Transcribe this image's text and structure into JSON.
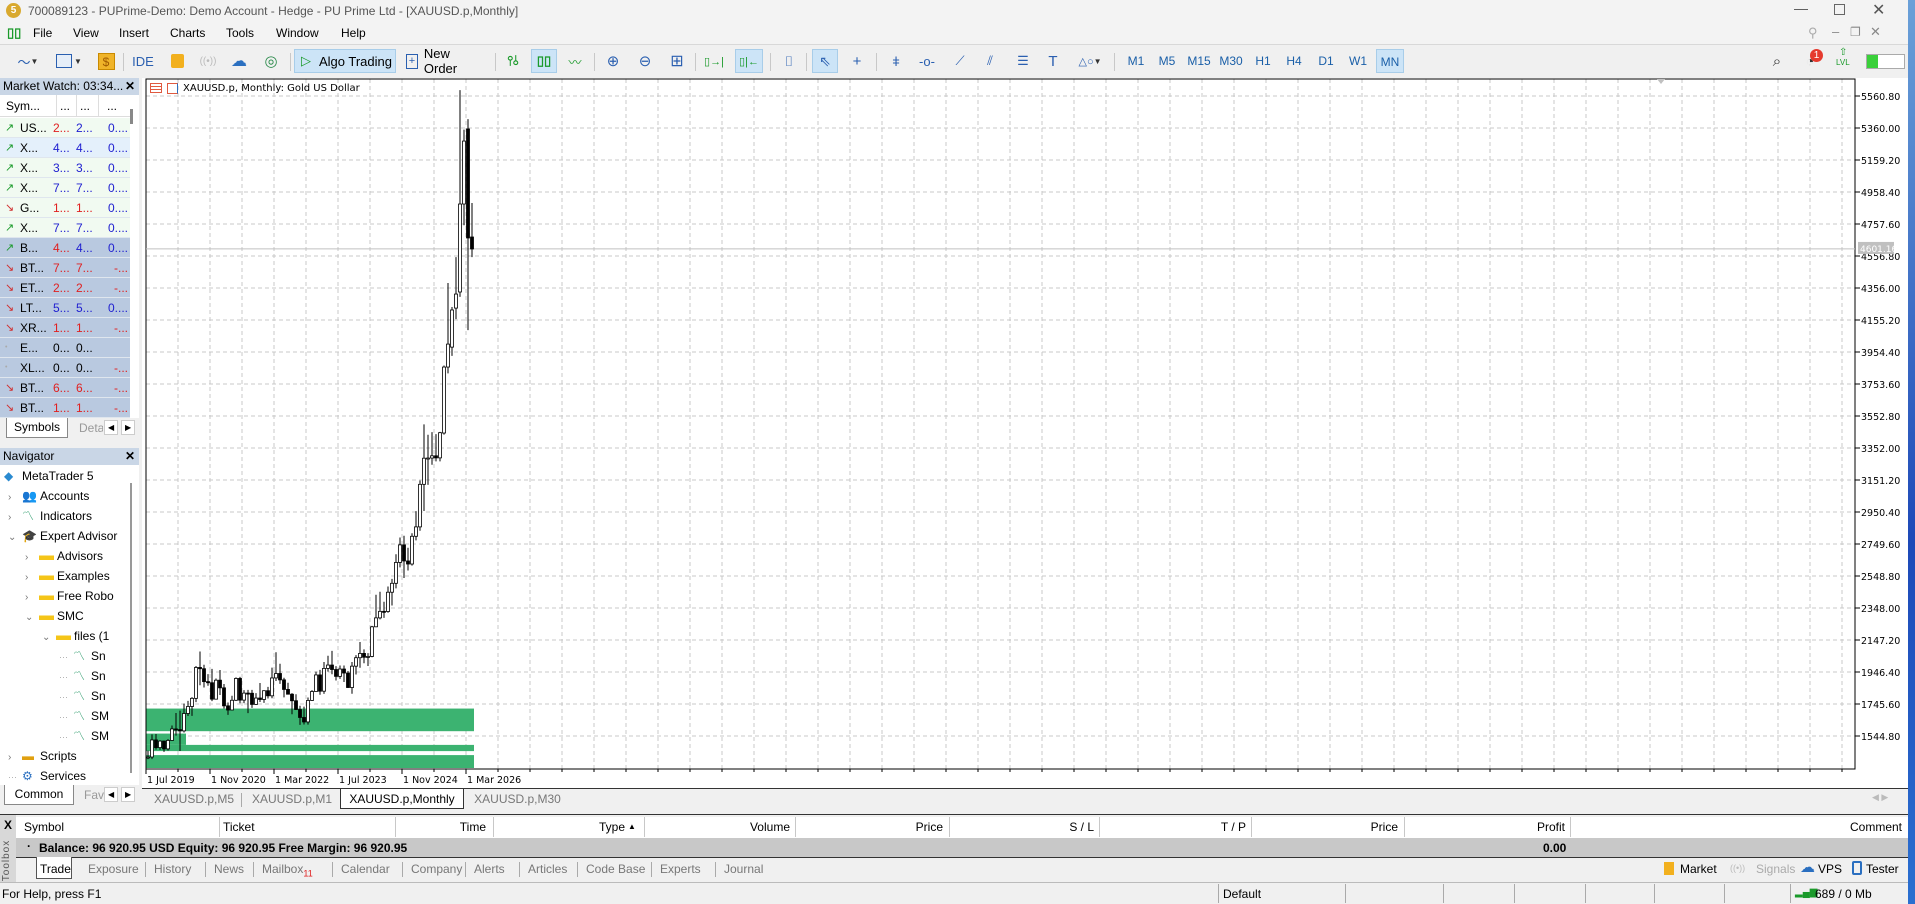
{
  "window": {
    "title": "700089123 - PUPrime-Demo: Demo Account - Hedge - PU Prime Ltd - [XAUUSD.p,Monthly]"
  },
  "menu": [
    "File",
    "View",
    "Insert",
    "Charts",
    "Tools",
    "Window",
    "Help"
  ],
  "toolbar": {
    "ide_label": "IDE",
    "algo_trading_label": "Algo Trading",
    "new_order_label": "New Order",
    "timeframes": [
      "M1",
      "M5",
      "M15",
      "M30",
      "H1",
      "H4",
      "D1",
      "W1",
      "MN"
    ],
    "active_timeframe": "MN",
    "notification_count": "1",
    "lvl_label": "LVL",
    "connection_level_pct": 30
  },
  "market_watch": {
    "title": "Market Watch: 03:34...",
    "columns": [
      "Sym...",
      "...",
      "...",
      "..."
    ],
    "rows": [
      {
        "dir": "up",
        "symbol": "US...",
        "bid": "2...",
        "ask": "2...",
        "chg": "0....",
        "bc": "#e02020",
        "ac": "#2020d0",
        "cc": "#2020d0",
        "sel": false,
        "bg": "#f1faf1"
      },
      {
        "dir": "up",
        "symbol": "X...",
        "bid": "4...",
        "ask": "4...",
        "chg": "0....",
        "bc": "#2020d0",
        "ac": "#2020d0",
        "cc": "#2020d0",
        "sel": false,
        "bg": "#e4f0fb"
      },
      {
        "dir": "up",
        "symbol": "X...",
        "bid": "3...",
        "ask": "3...",
        "chg": "0....",
        "bc": "#2020d0",
        "ac": "#2020d0",
        "cc": "#2020d0",
        "sel": false,
        "bg": "#f1faf1"
      },
      {
        "dir": "up",
        "symbol": "X...",
        "bid": "7...",
        "ask": "7...",
        "chg": "0....",
        "bc": "#2020d0",
        "ac": "#2020d0",
        "cc": "#2020d0",
        "sel": false,
        "bg": "#f1faf1"
      },
      {
        "dir": "down",
        "symbol": "G...",
        "bid": "1...",
        "ask": "1...",
        "chg": "0....",
        "bc": "#e02020",
        "ac": "#e02020",
        "cc": "#2020d0",
        "sel": false,
        "bg": "#f1faf1"
      },
      {
        "dir": "up",
        "symbol": "X...",
        "bid": "7...",
        "ask": "7...",
        "chg": "0....",
        "bc": "#2020d0",
        "ac": "#2020d0",
        "cc": "#2020d0",
        "sel": false,
        "bg": "#f1faf1"
      },
      {
        "dir": "up",
        "symbol": "B...",
        "bid": "4...",
        "ask": "4...",
        "chg": "0....",
        "bc": "#e02020",
        "ac": "#2020d0",
        "cc": "#2020d0",
        "sel": true
      },
      {
        "dir": "down",
        "symbol": "BT...",
        "bid": "7...",
        "ask": "7...",
        "chg": "-...",
        "bc": "#e02020",
        "ac": "#e02020",
        "cc": "#e02020",
        "sel": true
      },
      {
        "dir": "down",
        "symbol": "ET...",
        "bid": "2...",
        "ask": "2...",
        "chg": "-...",
        "bc": "#e02020",
        "ac": "#e02020",
        "cc": "#e02020",
        "sel": true
      },
      {
        "dir": "down",
        "symbol": "LT...",
        "bid": "5...",
        "ask": "5...",
        "chg": "0....",
        "bc": "#2020d0",
        "ac": "#2020d0",
        "cc": "#2020d0",
        "sel": true
      },
      {
        "dir": "down",
        "symbol": "XR...",
        "bid": "1...",
        "ask": "1...",
        "chg": "-...",
        "bc": "#e02020",
        "ac": "#e02020",
        "cc": "#e02020",
        "sel": true
      },
      {
        "dir": "none",
        "symbol": "E...",
        "bid": "0...",
        "ask": "0...",
        "chg": "",
        "bc": "#000000",
        "ac": "#000000",
        "cc": "#000000",
        "sel": true
      },
      {
        "dir": "none",
        "symbol": "XL...",
        "bid": "0...",
        "ask": "0...",
        "chg": "-...",
        "bc": "#000000",
        "ac": "#000000",
        "cc": "#e02020",
        "sel": true
      },
      {
        "dir": "down",
        "symbol": "BT...",
        "bid": "6...",
        "ask": "6...",
        "chg": "-...",
        "bc": "#e02020",
        "ac": "#e02020",
        "cc": "#e02020",
        "sel": true
      },
      {
        "dir": "down",
        "symbol": "BT...",
        "bid": "1...",
        "ask": "1...",
        "chg": "-...",
        "bc": "#e02020",
        "ac": "#e02020",
        "cc": "#e02020",
        "sel": true
      }
    ],
    "tabs": [
      "Symbols",
      "Deta"
    ]
  },
  "navigator": {
    "title": "Navigator",
    "items": [
      {
        "label": "MetaTrader 5",
        "icon": "metatrader-icon",
        "level": 0,
        "exp": ""
      },
      {
        "label": "Accounts",
        "icon": "accounts-icon",
        "level": 1,
        "exp": ">"
      },
      {
        "label": "Indicators",
        "icon": "indicator-icon",
        "level": 1,
        "exp": ">"
      },
      {
        "label": "Expert Advisor",
        "icon": "expert-icon",
        "level": 1,
        "exp": "v"
      },
      {
        "label": "Advisors",
        "icon": "folder-icon",
        "level": 2,
        "exp": ">"
      },
      {
        "label": "Examples",
        "icon": "folder-icon",
        "level": 2,
        "exp": ">"
      },
      {
        "label": "Free Robo",
        "icon": "folder-icon",
        "level": 2,
        "exp": ">"
      },
      {
        "label": "SMC",
        "icon": "folder-icon",
        "level": 2,
        "exp": "v"
      },
      {
        "label": "files (1",
        "icon": "folder-icon",
        "level": 3,
        "exp": "v"
      },
      {
        "label": "Sn",
        "icon": "indicator-icon",
        "level": 4,
        "exp": ""
      },
      {
        "label": "Sn",
        "icon": "indicator-icon",
        "level": 4,
        "exp": ""
      },
      {
        "label": "Sn",
        "icon": "indicator-icon",
        "level": 4,
        "exp": ""
      },
      {
        "label": "SM",
        "icon": "indicator-icon",
        "level": 4,
        "exp": ""
      },
      {
        "label": "SM",
        "icon": "indicator-icon",
        "level": 4,
        "exp": ""
      },
      {
        "label": "Scripts",
        "icon": "script-icon",
        "level": 1,
        "exp": ">"
      },
      {
        "label": "Services",
        "icon": "services-icon",
        "level": 1,
        "exp": ""
      }
    ],
    "tabs": [
      "Common",
      "Fav"
    ]
  },
  "chart": {
    "header": "XAUUSD.p, Monthly:  Gold US Dollar",
    "tabs": [
      "XAUUSD.p,M5",
      "XAUUSD.p,M1",
      "XAUUSD.p,Monthly",
      "XAUUSD.p,M30"
    ],
    "active_tab": 2
  },
  "chart_data": {
    "type": "candlestick",
    "symbol": "XAUUSD.p",
    "timeframe": "Monthly",
    "y_ticks": [
      5560.8,
      5360.0,
      5159.2,
      4958.4,
      4757.6,
      4556.8,
      4356.0,
      4155.2,
      3954.4,
      3753.6,
      3552.8,
      3352.0,
      3151.2,
      2950.4,
      2749.6,
      2548.8,
      2348.0,
      2147.2,
      1946.4,
      1745.6,
      1544.8
    ],
    "y_tick_labels": [
      "5560.80",
      "5360.00",
      "5159.20",
      "4958.40",
      "4757.60",
      "4556.80",
      "4356.00",
      "4155.20",
      "3954.40",
      "3753.60",
      "3552.80",
      "3352.00",
      "3151.20",
      "2950.40",
      "2749.60",
      "2548.80",
      "2348.00",
      "2147.20",
      "1946.40",
      "1745.60",
      "1544.80"
    ],
    "x_labels": [
      "1 Jul 2019",
      "1 Nov 2020",
      "1 Mar 2022",
      "1 Jul 2023",
      "1 Nov 2024",
      "1 Mar 2026"
    ],
    "current_price": "4601.16",
    "grid": true,
    "start_month": "2019-07",
    "ohlc": [
      [
        1409,
        1453,
        1400,
        1413
      ],
      [
        1413,
        1555,
        1400,
        1520
      ],
      [
        1520,
        1557,
        1459,
        1472
      ],
      [
        1472,
        1518,
        1458,
        1513
      ],
      [
        1513,
        1516,
        1445,
        1464
      ],
      [
        1464,
        1525,
        1454,
        1517
      ],
      [
        1517,
        1611,
        1517,
        1589
      ],
      [
        1589,
        1689,
        1547,
        1585
      ],
      [
        1585,
        1704,
        1451,
        1577
      ],
      [
        1577,
        1748,
        1567,
        1686
      ],
      [
        1686,
        1765,
        1670,
        1730
      ],
      [
        1730,
        1789,
        1671,
        1781
      ],
      [
        1781,
        1984,
        1757,
        1975
      ],
      [
        1975,
        2075,
        1863,
        1967
      ],
      [
        1967,
        1992,
        1849,
        1886
      ],
      [
        1886,
        1933,
        1860,
        1879
      ],
      [
        1879,
        1966,
        1764,
        1776
      ],
      [
        1776,
        1906,
        1775,
        1895
      ],
      [
        1895,
        1959,
        1802,
        1847
      ],
      [
        1847,
        1871,
        1717,
        1734
      ],
      [
        1734,
        1755,
        1677,
        1708
      ],
      [
        1708,
        1797,
        1706,
        1769
      ],
      [
        1769,
        1913,
        1765,
        1906
      ],
      [
        1906,
        1916,
        1750,
        1770
      ],
      [
        1770,
        1833,
        1751,
        1814
      ],
      [
        1814,
        1834,
        1688,
        1813
      ],
      [
        1813,
        1834,
        1721,
        1743
      ],
      [
        1743,
        1814,
        1740,
        1783
      ],
      [
        1783,
        1877,
        1758,
        1774
      ],
      [
        1774,
        1831,
        1753,
        1829
      ],
      [
        1829,
        1853,
        1780,
        1797
      ],
      [
        1797,
        1974,
        1782,
        1909
      ],
      [
        1909,
        2070,
        1890,
        1937
      ],
      [
        1937,
        1998,
        1872,
        1897
      ],
      [
        1897,
        1910,
        1787,
        1837
      ],
      [
        1837,
        1879,
        1805,
        1807
      ],
      [
        1807,
        1814,
        1681,
        1766
      ],
      [
        1766,
        1807,
        1709,
        1711
      ],
      [
        1711,
        1735,
        1615,
        1661
      ],
      [
        1661,
        1729,
        1617,
        1633
      ],
      [
        1633,
        1786,
        1616,
        1768
      ],
      [
        1768,
        1833,
        1765,
        1824
      ],
      [
        1824,
        1949,
        1823,
        1928
      ],
      [
        1928,
        1960,
        1804,
        1826
      ],
      [
        1826,
        2009,
        1809,
        1969
      ],
      [
        1969,
        2048,
        1949,
        1990
      ],
      [
        1990,
        2079,
        1932,
        1962
      ],
      [
        1962,
        1983,
        1893,
        1919
      ],
      [
        1919,
        1987,
        1903,
        1965
      ],
      [
        1965,
        1987,
        1884,
        1940
      ],
      [
        1940,
        1953,
        1847,
        1849
      ],
      [
        1849,
        2009,
        1810,
        1983
      ],
      [
        1983,
        2052,
        1931,
        2036
      ],
      [
        2036,
        2135,
        1973,
        2063
      ],
      [
        2063,
        2088,
        2001,
        2039
      ],
      [
        2039,
        2065,
        1984,
        2044
      ],
      [
        2044,
        2236,
        2039,
        2230
      ],
      [
        2230,
        2431,
        2228,
        2286
      ],
      [
        2286,
        2450,
        2277,
        2327
      ],
      [
        2327,
        2387,
        2286,
        2326
      ],
      [
        2326,
        2483,
        2318,
        2447
      ],
      [
        2447,
        2531,
        2364,
        2503
      ],
      [
        2503,
        2685,
        2471,
        2634
      ],
      [
        2634,
        2790,
        2603,
        2744
      ],
      [
        2744,
        2801,
        2536,
        2643
      ],
      [
        2643,
        2726,
        2583,
        2624
      ],
      [
        2624,
        2817,
        2614,
        2798
      ],
      [
        2798,
        2956,
        2772,
        2857
      ],
      [
        2857,
        3148,
        2833,
        3124
      ],
      [
        3124,
        3500,
        2957,
        3288
      ],
      [
        3288,
        3435,
        3121,
        3289
      ],
      [
        3289,
        3452,
        3247,
        3303
      ],
      [
        3303,
        3439,
        3268,
        3290
      ],
      [
        3290,
        3453,
        3268,
        3448
      ],
      [
        3446,
        3870,
        3436,
        3860
      ],
      [
        3860,
        4387,
        3820,
        4004
      ],
      [
        3985,
        4237,
        3930,
        4218
      ],
      [
        4230,
        4550,
        4161,
        4318
      ],
      [
        4331,
        5598,
        4300,
        4883
      ],
      [
        4883,
        5350,
        4750,
        5278
      ],
      [
        5354,
        5416,
        4092,
        4670
      ],
      [
        4676,
        4889,
        4550,
        4601
      ]
    ],
    "zones": [
      {
        "from": "2019-07",
        "to": "2026-04",
        "low": 1575,
        "high": 1717,
        "color": "#3cb371"
      },
      {
        "from": "2019-07",
        "to": "2020-04",
        "low": 1489,
        "high": 1560,
        "color": "#3cb371"
      },
      {
        "from": "2019-07",
        "to": "2026-04",
        "low": 1450,
        "high": 1489,
        "color": "#3cb371"
      },
      {
        "from": "2019-07",
        "to": "2026-04",
        "low": 1344,
        "high": 1425,
        "color": "#3cb371"
      }
    ]
  },
  "toolbox": {
    "side_label": "Toolbox",
    "columns": [
      "Symbol",
      "Ticket",
      "Time",
      "Type",
      "Volume",
      "Price",
      "S / L",
      "T / P",
      "Price",
      "Profit",
      "Comment"
    ],
    "balance_text": "Balance: 96 920.95 USD  Equity: 96 920.95  Free Margin: 96 920.95",
    "profit_total": "0.00",
    "tabs": [
      "Trade",
      "Exposure",
      "History",
      "News",
      "Mailbox",
      "Calendar",
      "Company",
      "Alerts",
      "Articles",
      "Code Base",
      "Experts",
      "Journal"
    ],
    "mailbox_count": "11",
    "right_buttons": [
      "Market",
      "Signals",
      "VPS",
      "Tester"
    ]
  },
  "status": {
    "help": "For Help, press F1",
    "profile": "Default",
    "traffic": "689 / 0 Mb"
  }
}
